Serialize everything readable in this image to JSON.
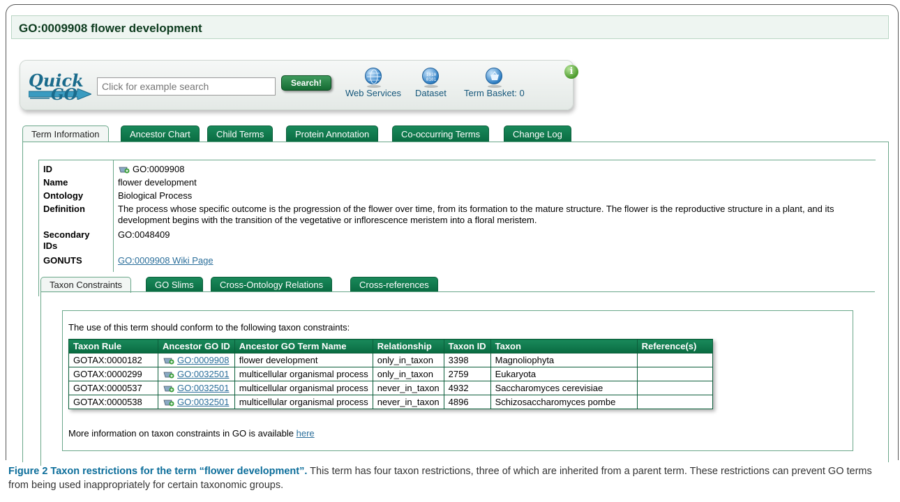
{
  "page_title": "GO:0009908 flower development",
  "quickgo": {
    "logo_line1": "Quick",
    "logo_line2": "GO",
    "search_placeholder": "Click for example search",
    "search_button": "Search!",
    "tools": [
      {
        "label": "Web Services",
        "icon": "globe-icon"
      },
      {
        "label": "Dataset",
        "icon": "database-icon"
      },
      {
        "label": "Term Basket: 0",
        "icon": "basket-icon"
      }
    ],
    "info_glyph": "i"
  },
  "tabs": [
    {
      "label": "Term Information",
      "active": true
    },
    {
      "label": "Ancestor Chart",
      "active": false
    },
    {
      "label": "Child Terms",
      "active": false
    },
    {
      "label": "Protein Annotation",
      "active": false
    },
    {
      "label": "Co-occurring Terms",
      "active": false
    },
    {
      "label": "Change Log",
      "active": false
    }
  ],
  "term": {
    "id_label": "ID",
    "id_value": "GO:0009908",
    "name_label": "Name",
    "name_value": "flower development",
    "ontology_label": "Ontology",
    "ontology_value": "Biological Process",
    "definition_label": "Definition",
    "definition_value": "The process whose specific outcome is the progression of the flower over time, from its formation to the mature structure. The flower is the reproductive structure in a plant, and its development begins with the transition of the vegetative or inflorescence meristem into a floral meristem.",
    "secondary_label_1": "Secondary",
    "secondary_label_2": "IDs",
    "secondary_value": "GO:0048409",
    "gonuts_label": "GONUTS",
    "gonuts_link": "GO:0009908 Wiki Page"
  },
  "subtabs": [
    {
      "label": "Taxon Constraints",
      "active": true
    },
    {
      "label": "GO Slims",
      "active": false
    },
    {
      "label": "Cross-Ontology Relations",
      "active": false
    },
    {
      "label": "Cross-references",
      "active": false
    }
  ],
  "taxon": {
    "intro": "The use of this term should conform to the following taxon constraints:",
    "columns": [
      "Taxon Rule",
      "Ancestor GO ID",
      "Ancestor GO Term Name",
      "Relationship",
      "Taxon ID",
      "Taxon",
      "Reference(s)"
    ],
    "rows": [
      {
        "rule": "GOTAX:0000182",
        "go_id": "GO:0009908",
        "term_name": "flower development",
        "relationship": "only_in_taxon",
        "taxon_id": "3398",
        "taxon": "Magnoliophyta",
        "refs": ""
      },
      {
        "rule": "GOTAX:0000299",
        "go_id": "GO:0032501",
        "term_name": "multicellular organismal process",
        "relationship": "only_in_taxon",
        "taxon_id": "2759",
        "taxon": "Eukaryota",
        "refs": ""
      },
      {
        "rule": "GOTAX:0000537",
        "go_id": "GO:0032501",
        "term_name": "multicellular organismal process",
        "relationship": "never_in_taxon",
        "taxon_id": "4932",
        "taxon": "Saccharomyces cerevisiae",
        "refs": ""
      },
      {
        "rule": "GOTAX:0000538",
        "go_id": "GO:0032501",
        "term_name": "multicellular organismal process",
        "relationship": "never_in_taxon",
        "taxon_id": "4896",
        "taxon": "Schizosaccharomyces pombe",
        "refs": ""
      }
    ],
    "more_prefix": "More information on taxon constraints in GO is available ",
    "more_link": "here"
  },
  "caption": {
    "bold": "Figure 2 Taxon restrictions for the term “flower development”.",
    "text": " This term has four taxon restrictions, three of which are inherited from a parent term. These restrictions can prevent GO terms from being used inappropriately for certain taxonomic groups."
  }
}
